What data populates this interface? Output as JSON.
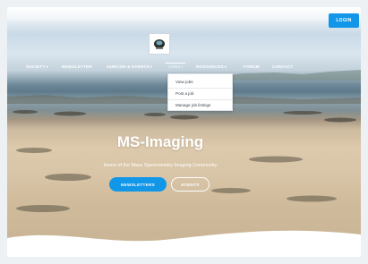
{
  "header": {
    "login_label": "LOGIN"
  },
  "nav": {
    "items": [
      {
        "label": "SOCIETY",
        "has_dropdown": true
      },
      {
        "label": "NEWSLETTER",
        "has_dropdown": false
      },
      {
        "label": "OURCON & EVENTS",
        "has_dropdown": true
      },
      {
        "label": "JOBS",
        "has_dropdown": true
      },
      {
        "label": "RESOURCES",
        "has_dropdown": true
      },
      {
        "label": "FORUM",
        "has_dropdown": false
      },
      {
        "label": "CONTACT",
        "has_dropdown": false
      }
    ],
    "dropdown_caret": "▾"
  },
  "dropdown": {
    "items": [
      "View jobs",
      "Post a job",
      "Manage job listings"
    ]
  },
  "hero": {
    "title": "MS-Imaging",
    "subtitle": "Home of the Mass Spectrometry Imaging Community",
    "primary_button": "NEWSLETTERS",
    "secondary_button": "EVENTS"
  },
  "colors": {
    "accent": "#1196e8",
    "text_on_hero": "#ffffff"
  }
}
